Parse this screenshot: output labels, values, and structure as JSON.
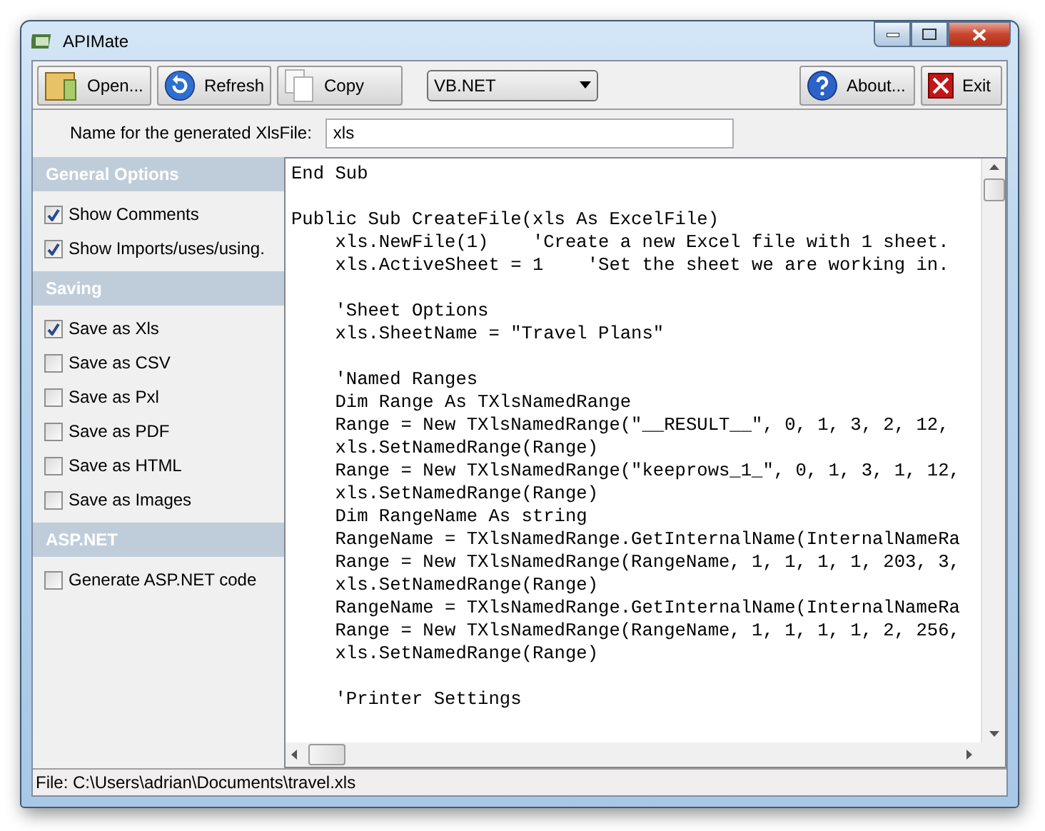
{
  "window": {
    "title": "APIMate"
  },
  "toolbar": {
    "buttons": [
      {
        "kind": "open",
        "label": "Open..."
      },
      {
        "kind": "refresh",
        "label": "Refresh"
      },
      {
        "kind": "copy",
        "label": "Copy"
      }
    ],
    "language": {
      "value": "VB.NET"
    },
    "right_buttons": [
      {
        "kind": "about",
        "label": "About..."
      },
      {
        "kind": "exit",
        "label": "Exit"
      }
    ]
  },
  "name_field": {
    "label": "Name for the generated XlsFile:",
    "value": "xls"
  },
  "sidebar": {
    "sections": [
      {
        "title": "General Options",
        "items": [
          {
            "label": "Show Comments",
            "checked": true
          },
          {
            "label": "Show Imports/uses/using.",
            "checked": true
          }
        ]
      },
      {
        "title": "Saving",
        "items": [
          {
            "label": "Save as Xls",
            "checked": true
          },
          {
            "label": "Save as CSV",
            "checked": false
          },
          {
            "label": "Save as Pxl",
            "checked": false
          },
          {
            "label": "Save as PDF",
            "checked": false
          },
          {
            "label": "Save as HTML",
            "checked": false
          },
          {
            "label": "Save as Images",
            "checked": false
          }
        ]
      },
      {
        "title": "ASP.NET",
        "items": [
          {
            "label": "Generate ASP.NET code",
            "checked": false
          }
        ]
      }
    ]
  },
  "code": {
    "blocks": [
      [
        "End Sub"
      ],
      [
        "Public Sub CreateFile(xls As ExcelFile)",
        "    xls.NewFile(1)    'Create a new Excel file with 1 sheet.",
        "    xls.ActiveSheet = 1    'Set the sheet we are working in."
      ],
      [
        "    'Sheet Options",
        "    xls.SheetName = \"Travel Plans\""
      ],
      [
        "    'Named Ranges",
        "    Dim Range As TXlsNamedRange",
        "    Range = New TXlsNamedRange(\"__RESULT__\", 0, 1, 3, 2, 12,",
        "    xls.SetNamedRange(Range)",
        "    Range = New TXlsNamedRange(\"keeprows_1_\", 0, 1, 3, 1, 12,",
        "    xls.SetNamedRange(Range)",
        "    Dim RangeName As string",
        "    RangeName = TXlsNamedRange.GetInternalName(InternalNameRa",
        "    Range = New TXlsNamedRange(RangeName, 1, 1, 1, 1, 203, 3,",
        "    xls.SetNamedRange(Range)",
        "    RangeName = TXlsNamedRange.GetInternalName(InternalNameRa",
        "    Range = New TXlsNamedRange(RangeName, 1, 1, 1, 1, 2, 256,",
        "    xls.SetNamedRange(Range)"
      ],
      [
        "    'Printer Settings"
      ]
    ]
  },
  "status_bar": {
    "text": "File: C:\\Users\\adrian\\Documents\\travel.xls"
  }
}
